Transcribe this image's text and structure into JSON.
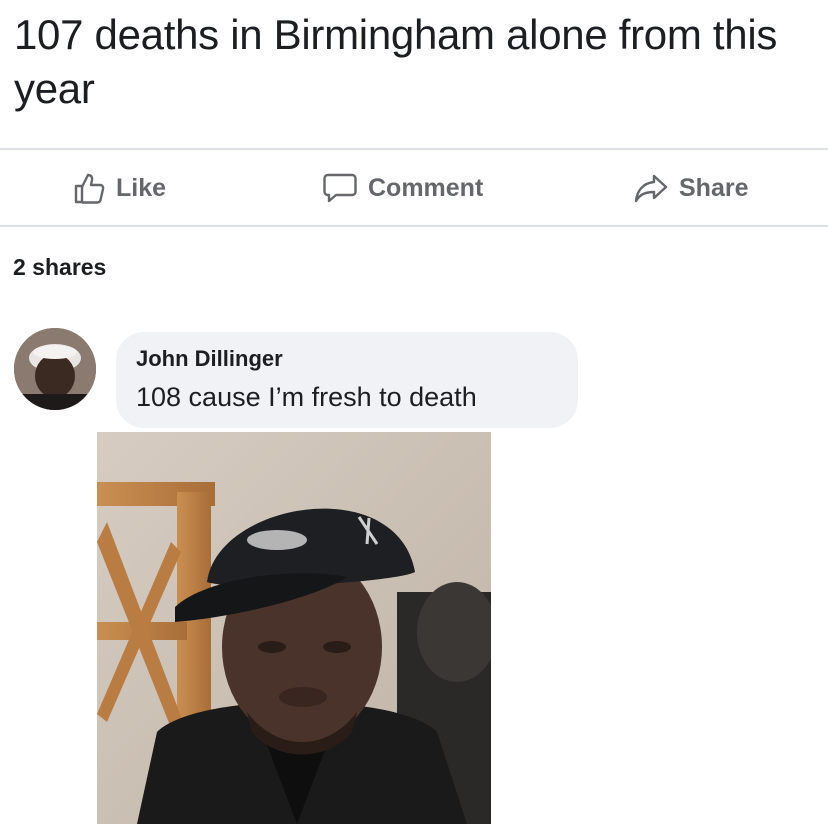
{
  "post": {
    "text": "107 deaths in Birmingham alone from this year"
  },
  "actions": {
    "like_label": "Like",
    "comment_label": "Comment",
    "share_label": "Share"
  },
  "engagement": {
    "shares": "2 shares"
  },
  "comment": {
    "author": "John Dillinger",
    "text": "108 cause I’m fresh to death"
  },
  "colors": {
    "action_text": "#65676b",
    "bubble_bg": "#f0f2f5",
    "divider": "#dcdfe3"
  },
  "icons": {
    "like": "thumbs-up-icon",
    "comment": "speech-bubble-icon",
    "share": "share-arrow-icon"
  }
}
